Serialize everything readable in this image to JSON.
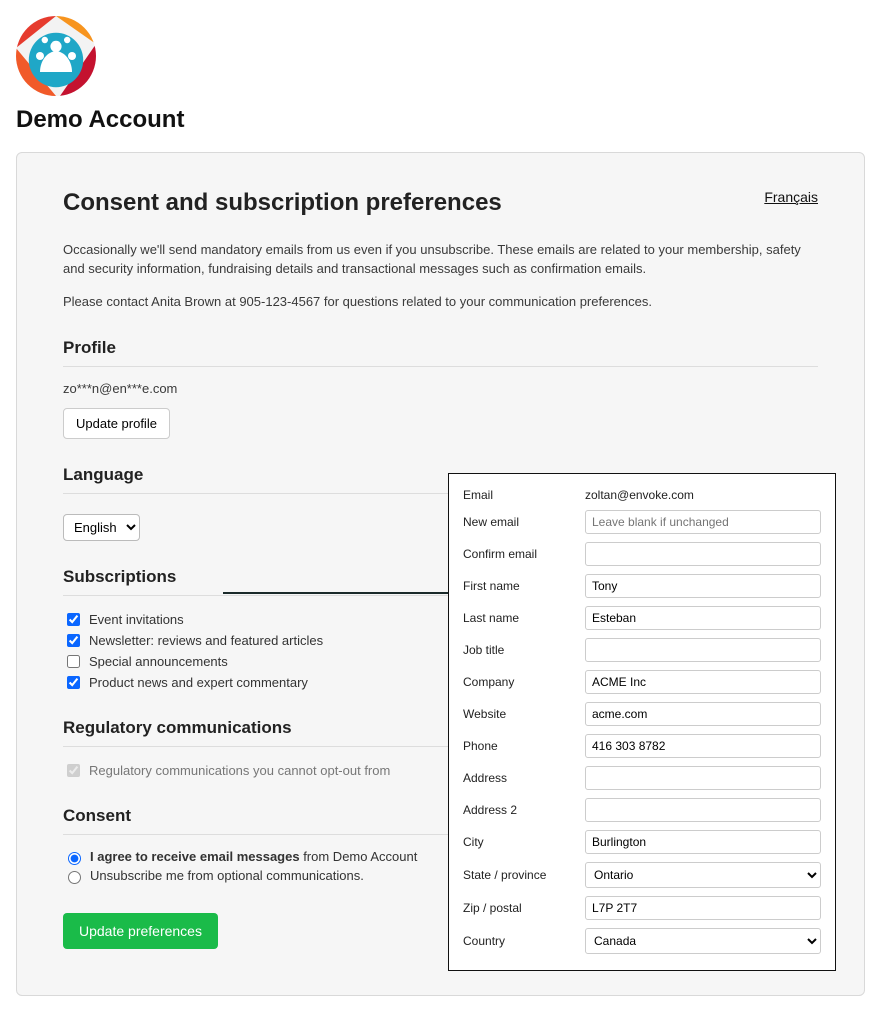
{
  "header": {
    "account_title": "Demo Account"
  },
  "card": {
    "title": "Consent and subscription preferences",
    "lang_link": "Français",
    "intro1": "Occasionally we'll send mandatory emails from us even if you unsubscribe. These emails are related to your membership, safety and security information, fundraising details and transactional messages such as confirmation emails.",
    "intro2": "Please contact Anita Brown at 905-123-4567 for questions related to your communication preferences."
  },
  "profile": {
    "heading": "Profile",
    "masked_email": "zo***n@en***e.com",
    "update_btn": "Update profile"
  },
  "language": {
    "heading": "Language",
    "selected": "English"
  },
  "subs": {
    "heading": "Subscriptions",
    "opt1": "Event invitations",
    "opt2": "Newsletter: reviews and featured articles",
    "opt3": "Special announcements",
    "opt4": "Product news and expert commentary"
  },
  "regulatory": {
    "heading": "Regulatory communications",
    "item": "Regulatory communications you cannot opt-out from"
  },
  "consent": {
    "heading": "Consent",
    "agree_prefix": "I agree to receive email messages",
    "agree_suffix": " from Demo Account",
    "unsub": "Unsubscribe me from optional communications."
  },
  "submit": {
    "label": "Update preferences"
  },
  "panel": {
    "email_lbl": "Email",
    "email_val": "zoltan@envoke.com",
    "newemail_lbl": "New email",
    "newemail_ph": "Leave blank if unchanged",
    "confirm_lbl": "Confirm email",
    "first_lbl": "First name",
    "first_val": "Tony",
    "last_lbl": "Last name",
    "last_val": "Esteban",
    "job_lbl": "Job title",
    "company_lbl": "Company",
    "company_val": "ACME Inc",
    "website_lbl": "Website",
    "website_val": "acme.com",
    "phone_lbl": "Phone",
    "phone_val": "416 303 8782",
    "addr_lbl": "Address",
    "addr2_lbl": "Address 2",
    "city_lbl": "City",
    "city_val": "Burlington",
    "state_lbl": "State / province",
    "state_val": "Ontario",
    "zip_lbl": "Zip / postal",
    "zip_val": "L7P 2T7",
    "country_lbl": "Country",
    "country_val": "Canada"
  }
}
